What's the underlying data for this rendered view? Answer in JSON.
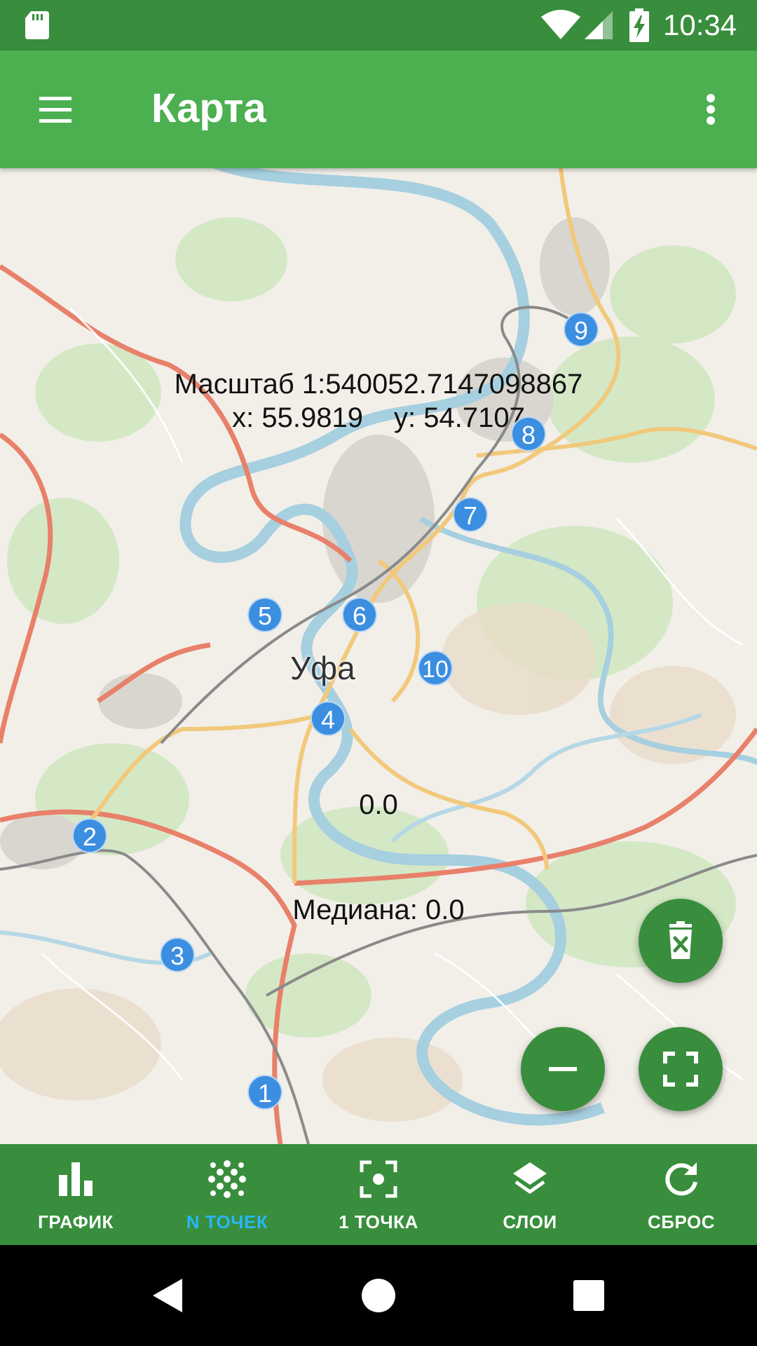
{
  "status_bar": {
    "time": "10:34",
    "icons": [
      "sd-card-icon",
      "wifi-icon",
      "cell-signal-icon",
      "battery-charging-icon"
    ]
  },
  "app_bar": {
    "title": "Карта",
    "menu_icon": "hamburger-menu-icon",
    "more_icon": "more-vert-icon"
  },
  "map": {
    "scale_text": "Масштаб 1:540052.7147098867",
    "x_text": "x: 55.9819",
    "y_text": "y: 54.7107",
    "value_text": "0.0",
    "median_text": "Медиана: 0.0",
    "city_label": "Уфа",
    "markers": [
      "1",
      "2",
      "3",
      "4",
      "5",
      "6",
      "7",
      "8",
      "9",
      "10"
    ],
    "marker_color": "#3b8ee0"
  },
  "fabs": {
    "delete_icon": "delete-x-icon",
    "zoom_out_icon": "minus-icon",
    "fullscreen_icon": "fullscreen-icon",
    "color": "#388e3c"
  },
  "bottom_nav": {
    "items": [
      {
        "label": "ГРАФИК",
        "icon": "bar-chart-icon"
      },
      {
        "label": "N ТОЧЕК",
        "icon": "scatter-dots-icon"
      },
      {
        "label": "1 ТОЧКА",
        "icon": "center-focus-icon"
      },
      {
        "label": "СЛОИ",
        "icon": "layers-icon"
      },
      {
        "label": "СБРОС",
        "icon": "refresh-icon"
      }
    ],
    "active_index": 1,
    "active_color": "#29b6f6"
  },
  "system_nav": {
    "icons": [
      "back-triangle-icon",
      "home-circle-icon",
      "recents-square-icon"
    ]
  }
}
